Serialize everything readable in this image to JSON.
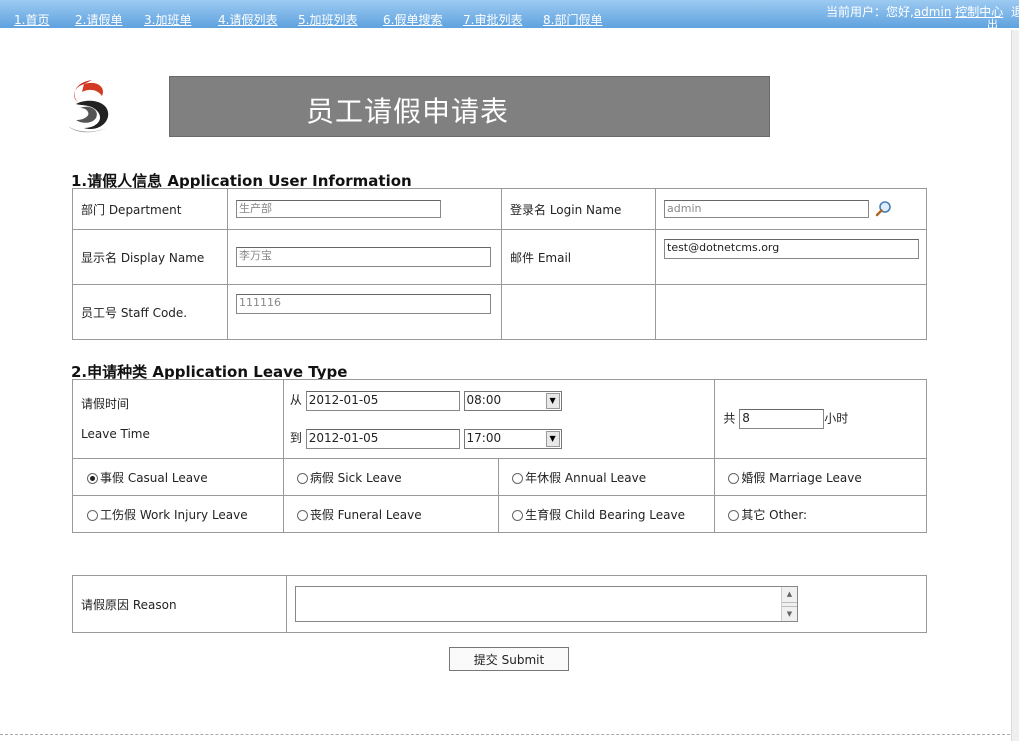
{
  "nav": {
    "items": [
      "1.首页",
      "2.请假单",
      "3.加班单",
      "4.请假列表",
      "5.加班列表",
      "6.假单搜索",
      "7.审批列表",
      "8.部门假单"
    ],
    "current_user_prefix": "当前用户：您好,",
    "username": "admin",
    "control_center": "控制中心",
    "exit_tail": "出",
    "cut_off": "退"
  },
  "header": {
    "title": "员工请假申请表"
  },
  "section1": {
    "title": "1.请假人信息  Application User Information",
    "department_label": "部门 Department",
    "department_value": "生产部",
    "login_label": "登录名 Login Name",
    "login_value": "admin",
    "display_label": "显示名 Display Name",
    "display_value": "李万宝",
    "email_label": "邮件 Email",
    "email_value": "test@dotnetcms.org",
    "staff_label": "员工号 Staff Code.",
    "staff_value": "111116"
  },
  "section2": {
    "title": "2.申请种类  Application Leave Type",
    "leave_time_cn": "请假时间",
    "leave_time_en": "Leave Time",
    "from_label": "从",
    "to_label": "到",
    "from_date": "2012-01-05",
    "from_time": "08:00",
    "to_date": "2012-01-05",
    "to_time": "17:00",
    "total_label": "共",
    "total_value": "8",
    "hours_label": "小时",
    "leave_types": [
      {
        "label": "事假 Casual Leave",
        "checked": true
      },
      {
        "label": "病假 Sick Leave",
        "checked": false
      },
      {
        "label": "年休假 Annual Leave",
        "checked": false
      },
      {
        "label": "婚假 Marriage Leave",
        "checked": false
      },
      {
        "label": "工伤假 Work Injury Leave",
        "checked": false
      },
      {
        "label": "丧假 Funeral Leave",
        "checked": false
      },
      {
        "label": "生育假 Child Bearing Leave",
        "checked": false
      },
      {
        "label": "其它 Other:",
        "checked": false
      }
    ]
  },
  "reason": {
    "label": "请假原因 Reason",
    "value": ""
  },
  "submit_label": "提交 Submit"
}
